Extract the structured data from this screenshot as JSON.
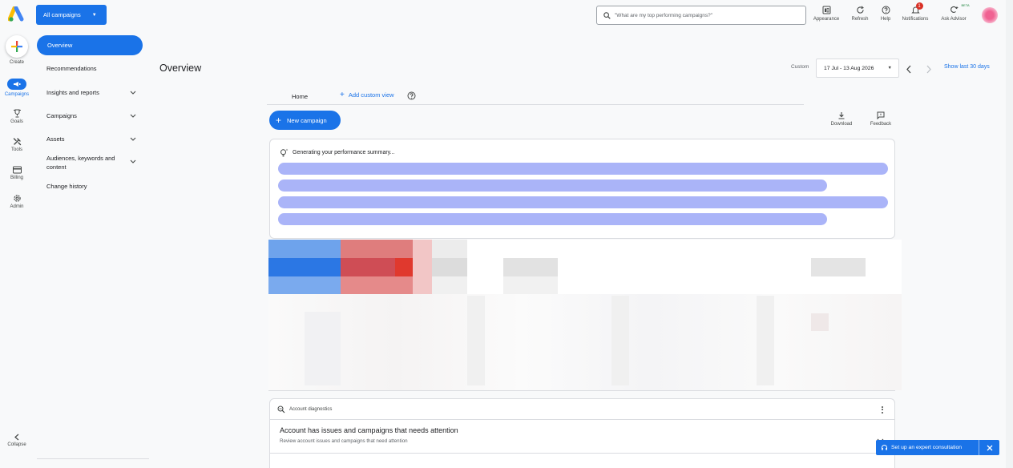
{
  "scope": {
    "label": "All campaigns"
  },
  "rail": {
    "create": "Create",
    "items": [
      {
        "label": "Campaigns",
        "icon": "megaphone-icon"
      },
      {
        "label": "Goals",
        "icon": "trophy-icon"
      },
      {
        "label": "Tools",
        "icon": "tools-icon"
      },
      {
        "label": "Billing",
        "icon": "card-icon"
      },
      {
        "label": "Admin",
        "icon": "gear-icon"
      }
    ],
    "collapse": "Collapse"
  },
  "nav": {
    "overview": "Overview",
    "recommendations": "Recommendations",
    "insights": "Insights and reports",
    "campaigns": "Campaigns",
    "assets": "Assets",
    "audiences_line1": "Audiences, keywords and",
    "audiences_line2": "content",
    "change_history": "Change history"
  },
  "search": {
    "placeholder": "\"What are my top performing campaigns?\""
  },
  "header": {
    "appearance": "Appearance",
    "refresh": "Refresh",
    "help": "Help",
    "notifications": "Notifications",
    "notification_count": "1",
    "ask_advisor": "Ask Advisor",
    "beta": "BETA"
  },
  "page": {
    "title": "Overview"
  },
  "date": {
    "custom_label": "Custom",
    "range": "17 Jul - 13 Aug 2026",
    "show_last": "Show last 30 days"
  },
  "tabs": {
    "home": "Home",
    "add_custom": "Add custom view"
  },
  "actions": {
    "new_campaign": "New campaign",
    "download": "Download",
    "feedback": "Feedback"
  },
  "summary": {
    "generating": "Generating your performance summary..."
  },
  "diagnostics": {
    "label": "Account diagnostics",
    "title": "Account has issues and campaigns that needs attention",
    "subtitle": "Review account issues and campaigns that need attention"
  },
  "consult": {
    "label": "Set up an expert consultation"
  },
  "colors": {
    "accent": "#1a73e8",
    "loading_bar": "#aab4f8"
  }
}
